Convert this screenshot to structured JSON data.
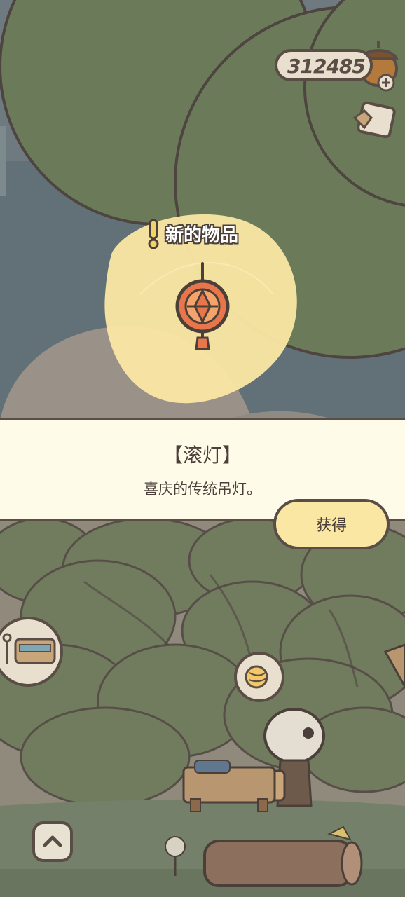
{
  "hud": {
    "currency_value": "312485",
    "currency_icon": "acorn-icon",
    "add_icon": "plus-icon",
    "journal_icon": "letter-icon"
  },
  "popup": {
    "new_item_label": "新的物品",
    "alert_icon": "exclamation-icon",
    "item_icon": "lantern-icon",
    "item_name": "【滚灯】",
    "item_description": "喜庆的传统吊灯。",
    "obtain_label": "获得"
  },
  "scene": {
    "train_station_icon": "train-station-icon",
    "yarn_bubble_icon": "yarn-ball-icon",
    "character": "sheep-traveler",
    "up_button_icon": "chevron-up-icon"
  },
  "colors": {
    "outline": "#5a4d45",
    "tree_green": "#6b7b5a",
    "backdrop": "#6f7a80",
    "glow": "#fbe7a4",
    "banner_bg": "#fffbe9",
    "lantern": "#e8764a"
  }
}
